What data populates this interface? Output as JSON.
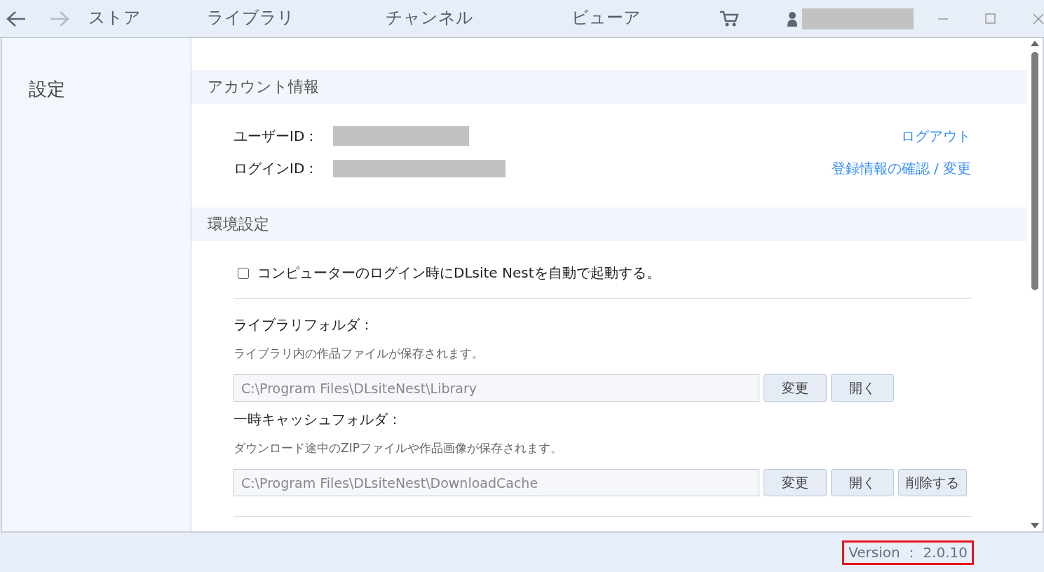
{
  "nav": {
    "back": {
      "disabled": false
    },
    "forward": {
      "disabled": true
    }
  },
  "tabs": [
    {
      "label": "ストア",
      "selected": false
    },
    {
      "label": "ライブラリ",
      "selected": false
    },
    {
      "label": "チャンネル",
      "selected": false
    },
    {
      "label": "ビューア",
      "selected": false
    }
  ],
  "sidebar": {
    "title": "設定"
  },
  "account": {
    "heading": "アカウント情報",
    "fields": [
      {
        "label": "ユーザーID："
      },
      {
        "label": "ログインID："
      }
    ],
    "links": [
      "ログアウト",
      "登録情報の確認 / 変更"
    ]
  },
  "preferences": {
    "heading": "環境設定",
    "autostart": {
      "label": "コンピューターのログイン時にDLsite Nestを自動で起動する。",
      "checked": false
    },
    "folders": [
      {
        "title": "ライブラリフォルダ：",
        "description": "ライブラリ内の作品ファイルが保存されます。",
        "path": "C:\\Program Files\\DLsiteNest\\Library",
        "buttons": [
          "変更",
          "開く"
        ]
      },
      {
        "title": "一時キャッシュフォルダ：",
        "description": "ダウンロード途中のZIPファイルや作品画像が保存されます。",
        "path": "C:\\Program Files\\DLsiteNest\\DownloadCache",
        "buttons": [
          "変更",
          "開く",
          "削除する"
        ]
      }
    ]
  },
  "footer": {
    "version": "Version ： 2.0.10"
  }
}
